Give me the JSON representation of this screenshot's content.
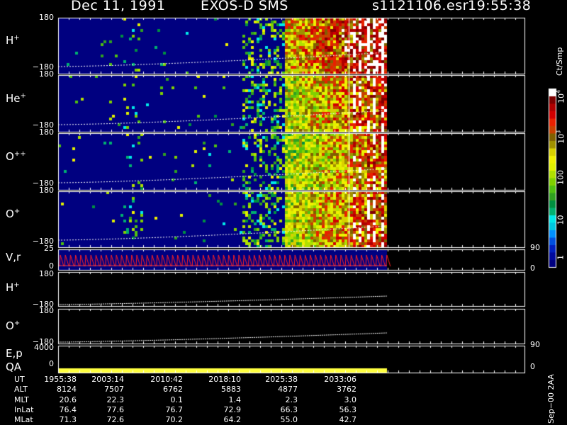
{
  "header": {
    "date": "Dec 11, 1991",
    "instrument": "EXOS-D SMS",
    "file": "s1121106.esr",
    "time": "19:55:38"
  },
  "panels": [
    {
      "species": "H",
      "charge": "+",
      "ymax": "180",
      "ymin": "−180"
    },
    {
      "species": "He",
      "charge": "+",
      "ymax": "180",
      "ymin": "−180"
    },
    {
      "species": "O",
      "charge": "++",
      "ymax": "180",
      "ymin": "−180"
    },
    {
      "species": "O",
      "charge": "+",
      "ymax": "180",
      "ymin": "−180"
    }
  ],
  "vr_panel": {
    "label": "V,r",
    "ytop": "25",
    "ybottom": "0",
    "right_top": "90",
    "right_bottom": "0"
  },
  "h_track": {
    "species": "H",
    "charge": "+",
    "ymax": "180",
    "ymin": "−180"
  },
  "o_track": {
    "species": "O",
    "charge": "+",
    "ymax": "180",
    "ymin": "−180",
    "right_label": "90"
  },
  "ep_panel": {
    "label": "E,p",
    "ytop": "4000",
    "ybottom": "0",
    "right_bottom": "0"
  },
  "qa_panel": {
    "label": "QA"
  },
  "colorbar": {
    "unit": "Ct/Smp",
    "ticks": [
      "1",
      "10",
      "100",
      "10",
      "10"
    ],
    "tick_exponents": [
      "",
      "",
      "",
      "3",
      "4"
    ],
    "colors": [
      "#000080",
      "#000a9c",
      "#0020c0",
      "#0050e0",
      "#0090ff",
      "#00c8e0",
      "#00e8e8",
      "#00b070",
      "#009040",
      "#30a020",
      "#50c010",
      "#80d000",
      "#b0e000",
      "#e0f000",
      "#f0f000",
      "#d8d000",
      "#a09000",
      "#806000",
      "#c84000",
      "#e82000",
      "#d00000",
      "#b00000",
      "#800000",
      "#ffffff"
    ]
  },
  "stamp": "Sep−00  2AA",
  "ephemeris": {
    "rows": [
      {
        "name": "UT",
        "values": [
          "1955:38",
          "2003:14",
          "2010:42",
          "2018:10",
          "2025:38",
          "2033:06"
        ]
      },
      {
        "name": "ALT",
        "values": [
          "8124",
          "7507",
          "6762",
          "5883",
          "4877",
          "3762"
        ]
      },
      {
        "name": "MLT",
        "values": [
          "20.6",
          "22.3",
          "0.1",
          "1.4",
          "2.3",
          "3.0"
        ]
      },
      {
        "name": "InLat",
        "values": [
          "76.4",
          "77.6",
          "76.7",
          "72.9",
          "66.3",
          "56.3"
        ]
      },
      {
        "name": "MLat",
        "values": [
          "71.3",
          "72.6",
          "70.2",
          "64.2",
          "55.0",
          "42.7"
        ]
      }
    ]
  },
  "chart_data": {
    "type": "heatmap",
    "x_times": [
      "1955:38",
      "2003:14",
      "2010:42",
      "2018:10",
      "2025:38",
      "2033:06"
    ],
    "x_range": [
      "1955:38",
      "2038:30"
    ],
    "data_end": "2038:30",
    "pitch_angle_range": [
      -180,
      180
    ],
    "color_scale": "log",
    "color_range": [
      1,
      10000
    ],
    "series": [
      {
        "species": "H+",
        "intensity_profile": [
          0.05,
          0.15,
          0.35,
          0.55,
          0.75,
          0.9
        ]
      },
      {
        "species": "He+",
        "intensity_profile": [
          0.02,
          0.05,
          0.2,
          0.45,
          0.65,
          0.8
        ]
      },
      {
        "species": "O++",
        "intensity_profile": [
          0.01,
          0.03,
          0.15,
          0.4,
          0.6,
          0.75
        ]
      },
      {
        "species": "O+",
        "intensity_profile": [
          0.01,
          0.03,
          0.18,
          0.45,
          0.65,
          0.8
        ]
      }
    ]
  }
}
